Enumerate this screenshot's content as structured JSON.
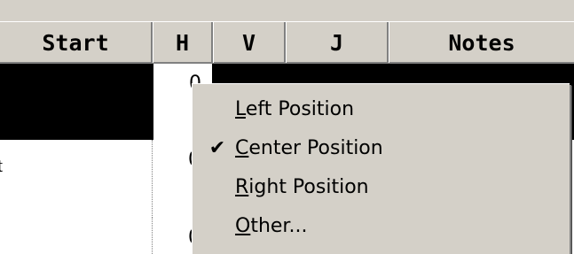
{
  "header": {
    "columns": [
      {
        "key": "start",
        "label": "Start"
      },
      {
        "key": "h",
        "label": "H"
      },
      {
        "key": "v",
        "label": "V"
      },
      {
        "key": "j",
        "label": "J"
      },
      {
        "key": "notes",
        "label": "Notes"
      }
    ]
  },
  "rows": [
    {
      "h": "0",
      "selected": true
    },
    {
      "h": "0",
      "start_fragment": "t"
    },
    {
      "h": "0"
    }
  ],
  "context_menu": {
    "items": [
      {
        "accel": "L",
        "rest": "eft Position",
        "checked": false
      },
      {
        "accel": "C",
        "rest": "enter Position",
        "checked": true
      },
      {
        "accel": "R",
        "rest": "ight Position",
        "checked": false
      },
      {
        "accel": "O",
        "rest": "ther...",
        "checked": false
      }
    ],
    "check_glyph": "✔"
  },
  "colors": {
    "chrome": "#d4d0c8",
    "selected_row": "#000000"
  }
}
